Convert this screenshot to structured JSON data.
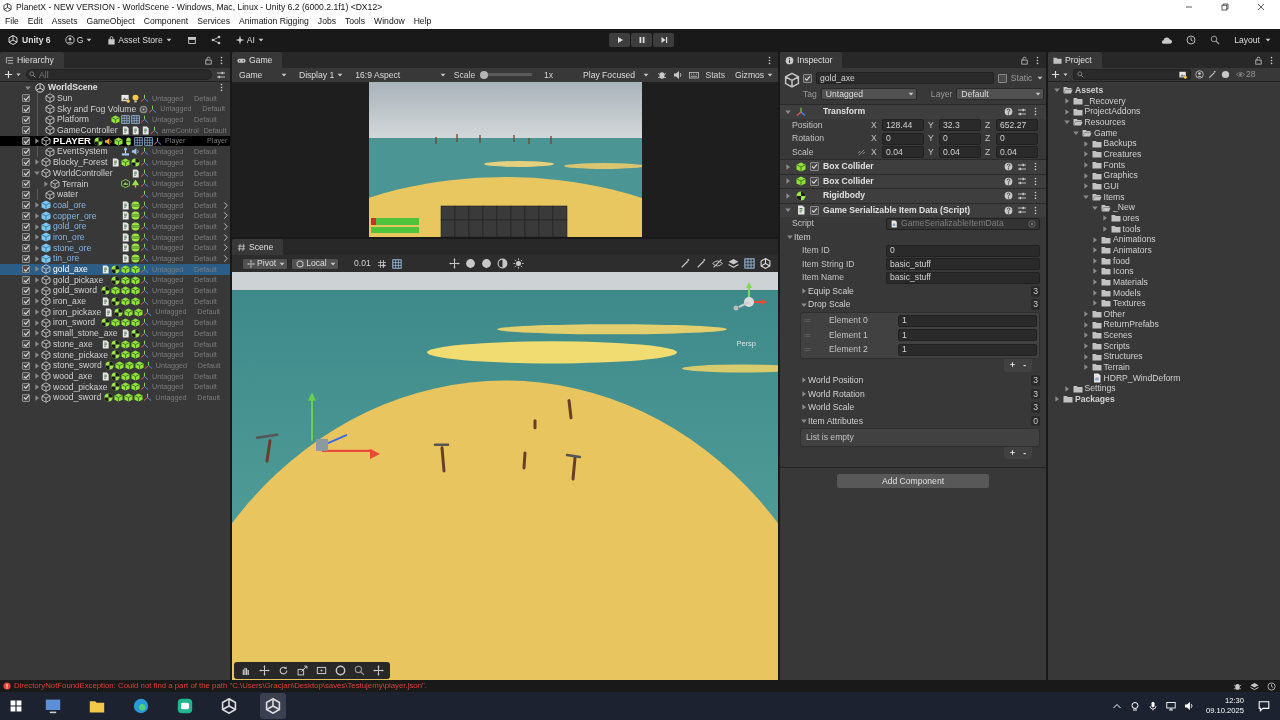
{
  "window": {
    "title": "PlanetX - NEW VERSION - WorldScene - Windows, Mac, Linux - Unity 6.2 (6000.2.1f1) <DX12>"
  },
  "menu": [
    "File",
    "Edit",
    "Assets",
    "GameObject",
    "Component",
    "Services",
    "Animation Rigging",
    "Jobs",
    "Tools",
    "Window",
    "Help"
  ],
  "toolbar": {
    "version": "Unity 6",
    "account": "G",
    "asset_store": "Asset Store",
    "ai": "AI",
    "layout": "Layout"
  },
  "hierarchy": {
    "tab": "Hierarchy",
    "search_placeholder": "All",
    "scene": {
      "name": "WorldScene",
      "expanded": true
    },
    "items": [
      {
        "name": "Sun",
        "kind": "object",
        "checked": true,
        "selected": false,
        "components": [
          {
            "kind": "picture"
          },
          {
            "kind": "light"
          }
        ],
        "tag": "Untagged",
        "layer": "Default"
      },
      {
        "name": "Sky and Fog Volume",
        "kind": "object",
        "checked": true,
        "selected": false,
        "components": [
          {
            "kind": "volume"
          }
        ],
        "tag": "Untagged",
        "layer": "Default"
      },
      {
        "name": "Platform",
        "kind": "object",
        "checked": true,
        "selected": false,
        "components": [
          {
            "kind": "collider"
          },
          {
            "kind": "grid"
          },
          {
            "kind": "grid"
          }
        ],
        "tag": "Untagged",
        "layer": "Default"
      },
      {
        "name": "GameController",
        "kind": "object",
        "checked": true,
        "selected": false,
        "components": [
          {
            "kind": "script"
          },
          {
            "kind": "script"
          },
          {
            "kind": "script"
          }
        ],
        "tag": "ameControl",
        "layer": "Default"
      },
      {
        "name": "PLAYER",
        "kind": "highlighted",
        "checked": true,
        "selected": false,
        "expanded": false,
        "components": [
          {
            "kind": "rigidbody"
          },
          {
            "kind": "audio"
          },
          {
            "kind": "collider"
          },
          {
            "kind": "capsule"
          },
          {
            "kind": "grid"
          },
          {
            "kind": "grid"
          }
        ],
        "tag": "Player",
        "layer": "Player"
      },
      {
        "name": "EventSystem",
        "kind": "object",
        "checked": true,
        "selected": false,
        "components": [
          {
            "kind": "joystick"
          },
          {
            "kind": "speaker"
          }
        ],
        "tag": "Untagged",
        "layer": "Default"
      },
      {
        "name": "Blocky_Forest",
        "kind": "object",
        "checked": true,
        "selected": false,
        "expanded": false,
        "components": [
          {
            "kind": "script"
          },
          {
            "kind": "collider"
          },
          {
            "kind": "rigidbody"
          }
        ],
        "tag": "Untagged",
        "layer": "Default"
      },
      {
        "name": "WorldController",
        "kind": "object",
        "checked": true,
        "selected": false,
        "expanded": true,
        "components": [
          {
            "kind": "script"
          }
        ],
        "tag": "Untagged",
        "layer": "Default",
        "children": [
          {
            "name": "Terrain",
            "kind": "object",
            "checked": true,
            "selected": false,
            "expanded": false,
            "components": [
              {
                "kind": "terrain"
              },
              {
                "kind": "tree"
              }
            ],
            "tag": "Untagged",
            "layer": "Default"
          }
        ]
      },
      {
        "name": "water",
        "kind": "object",
        "checked": true,
        "selected": false,
        "tag": "Untagged",
        "layer": "Default"
      },
      {
        "name": "coal_ore",
        "kind": "prefab",
        "checked": true,
        "selected": false,
        "expanded": false,
        "components": [
          {
            "kind": "script"
          },
          {
            "kind": "sphere"
          }
        ],
        "tag": "Untagged",
        "layer": "Default"
      },
      {
        "name": "copper_ore",
        "kind": "prefab",
        "checked": true,
        "selected": false,
        "expanded": false,
        "components": [
          {
            "kind": "script"
          },
          {
            "kind": "sphere"
          }
        ],
        "tag": "Untagged",
        "layer": "Default"
      },
      {
        "name": "gold_ore",
        "kind": "prefab",
        "checked": true,
        "selected": false,
        "expanded": false,
        "components": [
          {
            "kind": "script"
          },
          {
            "kind": "sphere"
          }
        ],
        "tag": "Untagged",
        "layer": "Default"
      },
      {
        "name": "iron_ore",
        "kind": "prefab",
        "checked": true,
        "selected": false,
        "expanded": false,
        "components": [
          {
            "kind": "script"
          },
          {
            "kind": "sphere"
          }
        ],
        "tag": "Untagged",
        "layer": "Default"
      },
      {
        "name": "stone_ore",
        "kind": "prefab",
        "checked": true,
        "selected": false,
        "expanded": false,
        "components": [
          {
            "kind": "script"
          },
          {
            "kind": "sphere"
          }
        ],
        "tag": "Untagged",
        "layer": "Default"
      },
      {
        "name": "tin_ore",
        "kind": "prefab",
        "checked": true,
        "selected": false,
        "expanded": false,
        "components": [
          {
            "kind": "script"
          },
          {
            "kind": "sphere"
          }
        ],
        "tag": "Untagged",
        "layer": "Default"
      },
      {
        "name": "gold_axe",
        "kind": "object",
        "checked": true,
        "selected": true,
        "expanded": false,
        "components": [
          {
            "kind": "script"
          },
          {
            "kind": "rigidbody"
          },
          {
            "kind": "collider"
          },
          {
            "kind": "collider"
          }
        ],
        "tag": "Untagged",
        "layer": "Default"
      },
      {
        "name": "gold_pickaxe",
        "kind": "object",
        "checked": true,
        "selected": false,
        "expanded": false,
        "components": [
          {
            "kind": "rigidbody"
          },
          {
            "kind": "collider"
          },
          {
            "kind": "collider"
          }
        ],
        "tag": "Untagged",
        "layer": "Default"
      },
      {
        "name": "gold_sword",
        "kind": "object",
        "checked": true,
        "selected": false,
        "expanded": false,
        "components": [
          {
            "kind": "rigidbody"
          },
          {
            "kind": "collider"
          },
          {
            "kind": "collider"
          },
          {
            "kind": "collider"
          }
        ],
        "tag": "Untagged",
        "layer": "Default"
      },
      {
        "name": "iron_axe",
        "kind": "object",
        "checked": true,
        "selected": false,
        "expanded": false,
        "components": [
          {
            "kind": "script"
          },
          {
            "kind": "rigidbody"
          },
          {
            "kind": "collider"
          },
          {
            "kind": "collider"
          }
        ],
        "tag": "Untagged",
        "layer": "Default"
      },
      {
        "name": "iron_pickaxe",
        "kind": "object",
        "checked": true,
        "selected": false,
        "expanded": false,
        "components": [
          {
            "kind": "script"
          },
          {
            "kind": "rigidbody"
          },
          {
            "kind": "collider"
          },
          {
            "kind": "collider"
          }
        ],
        "tag": "Untagged",
        "layer": "Default"
      },
      {
        "name": "iron_sword",
        "kind": "object",
        "checked": true,
        "selected": false,
        "expanded": false,
        "components": [
          {
            "kind": "rigidbody"
          },
          {
            "kind": "collider"
          },
          {
            "kind": "collider"
          },
          {
            "kind": "collider"
          }
        ],
        "tag": "Untagged",
        "layer": "Default"
      },
      {
        "name": "small_stone_axe",
        "kind": "object",
        "checked": true,
        "selected": false,
        "expanded": false,
        "components": [
          {
            "kind": "script"
          },
          {
            "kind": "rigidbody"
          }
        ],
        "tag": "Untagged",
        "layer": "Default"
      },
      {
        "name": "stone_axe",
        "kind": "object",
        "checked": true,
        "selected": false,
        "expanded": false,
        "components": [
          {
            "kind": "script"
          },
          {
            "kind": "rigidbody"
          },
          {
            "kind": "collider"
          },
          {
            "kind": "collider"
          }
        ],
        "tag": "Untagged",
        "layer": "Default"
      },
      {
        "name": "stone_pickaxe",
        "kind": "object",
        "checked": true,
        "selected": false,
        "expanded": false,
        "components": [
          {
            "kind": "rigidbody"
          },
          {
            "kind": "collider"
          },
          {
            "kind": "collider"
          }
        ],
        "tag": "Untagged",
        "layer": "Default"
      },
      {
        "name": "stone_sword",
        "kind": "object",
        "checked": true,
        "selected": false,
        "expanded": false,
        "components": [
          {
            "kind": "rigidbody"
          },
          {
            "kind": "collider"
          },
          {
            "kind": "collider"
          },
          {
            "kind": "collider"
          }
        ],
        "tag": "Untagged",
        "layer": "Default"
      },
      {
        "name": "wood_axe",
        "kind": "object",
        "checked": true,
        "selected": false,
        "expanded": false,
        "components": [
          {
            "kind": "script"
          },
          {
            "kind": "rigidbody"
          },
          {
            "kind": "collider"
          },
          {
            "kind": "collider"
          }
        ],
        "tag": "Untagged",
        "layer": "Default"
      },
      {
        "name": "wood_pickaxe",
        "kind": "object",
        "checked": true,
        "selected": false,
        "expanded": false,
        "components": [
          {
            "kind": "rigidbody"
          },
          {
            "kind": "collider"
          },
          {
            "kind": "collider"
          }
        ],
        "tag": "Untagged",
        "layer": "Default"
      },
      {
        "name": "wood_sword",
        "kind": "object",
        "checked": true,
        "selected": false,
        "expanded": false,
        "components": [
          {
            "kind": "rigidbody"
          },
          {
            "kind": "collider"
          },
          {
            "kind": "collider"
          },
          {
            "kind": "collider"
          }
        ],
        "tag": "Untagged",
        "layer": "Default"
      }
    ]
  },
  "game": {
    "tab": "Game",
    "view": "Game",
    "display": "Display 1",
    "aspect": "16:9 Aspect",
    "scale_label": "Scale",
    "scale_slider": {
      "level": 0.06
    },
    "scale": "1x",
    "play_mode": "Play Focused",
    "stats": "Stats",
    "gizmos": "Gizmos"
  },
  "scene": {
    "tab": "Scene",
    "pivot": "Pivot",
    "space": "Local",
    "snap": "0.01",
    "projection": "Persp"
  },
  "inspector": {
    "tab": "Inspector",
    "object": {
      "name": "gold_axe",
      "active": true,
      "static_label": "Static",
      "static": false,
      "tag_label": "Tag",
      "tag": "Untagged",
      "layer_label": "Layer",
      "layer": "Default"
    },
    "components": [
      {
        "kind": "transform",
        "title": "Transform",
        "expanded": true,
        "rows": [
          {
            "label": "Position",
            "axes": [
              {
                "axis": "X",
                "value": "128.44"
              },
              {
                "axis": "Y",
                "value": "32.3"
              },
              {
                "axis": "Z",
                "value": "652.27"
              }
            ]
          },
          {
            "label": "Rotation",
            "axes": [
              {
                "axis": "X",
                "value": "0"
              },
              {
                "axis": "Y",
                "value": "0"
              },
              {
                "axis": "Z",
                "value": "0"
              }
            ]
          },
          {
            "label": "Scale",
            "scale_link": false,
            "axes": [
              {
                "axis": "X",
                "value": "0.04"
              },
              {
                "axis": "Y",
                "value": "0.04"
              },
              {
                "axis": "Z",
                "value": "0.04"
              }
            ]
          }
        ]
      },
      {
        "kind": "collider",
        "title": "Box Collider",
        "expanded": false,
        "enabled": true
      },
      {
        "kind": "collider",
        "title": "Box Collider",
        "expanded": false,
        "enabled": true
      },
      {
        "kind": "rigidbody",
        "title": "Rigidbody",
        "expanded": false
      },
      {
        "kind": "script",
        "title": "Game Serializable Item Data (Script)",
        "expanded": true,
        "enabled": true,
        "script_label": "Script",
        "script": "GameSerializableItemData",
        "group": {
          "label": "Item",
          "expanded": true,
          "fields": [
            {
              "kind": "field",
              "label": "Item ID",
              "value": "0"
            },
            {
              "kind": "field",
              "label": "Item String ID",
              "value": "basic_stuff"
            },
            {
              "kind": "field",
              "label": "Item Name",
              "value": "basic_stuff"
            },
            {
              "kind": "list",
              "label": "Equip Scale",
              "count": "3",
              "expanded": false
            },
            {
              "kind": "list",
              "label": "Drop Scale",
              "count": "3",
              "expanded": true,
              "elements": [
                {
                  "label": "Element 0",
                  "value": "1"
                },
                {
                  "label": "Element 1",
                  "value": "1"
                },
                {
                  "label": "Element 2",
                  "value": "1"
                }
              ],
              "add": "+",
              "remove": "-"
            },
            {
              "kind": "list",
              "label": "World Position",
              "count": "3",
              "expanded": false
            },
            {
              "kind": "list",
              "label": "World Rotation",
              "count": "3",
              "expanded": false
            },
            {
              "kind": "list",
              "label": "World Scale",
              "count": "3",
              "expanded": false
            },
            {
              "kind": "list",
              "label": "Item Attributes",
              "count": "0",
              "expanded": true,
              "empty_text": "List is empty",
              "add": "+",
              "remove": "-"
            }
          ]
        }
      }
    ],
    "add_component": "Add Component"
  },
  "project": {
    "tab": "Project",
    "hidden_count": "28",
    "tree": [
      {
        "name": "Assets",
        "kind": "folder",
        "expanded": true,
        "children": [
          {
            "name": "_Recovery",
            "kind": "folder",
            "expanded": false
          },
          {
            "name": "ProjectAddons",
            "kind": "folder",
            "expanded": false
          },
          {
            "name": "Resources",
            "kind": "folder",
            "expanded": true,
            "children": [
              {
                "name": "Game",
                "kind": "folder",
                "expanded": true,
                "children": [
                  {
                    "name": "Backups",
                    "kind": "folder",
                    "expanded": false
                  },
                  {
                    "name": "Creatures",
                    "kind": "folder",
                    "expanded": false
                  },
                  {
                    "name": "Fonts",
                    "kind": "folder",
                    "expanded": false
                  },
                  {
                    "name": "Graphics",
                    "kind": "folder",
                    "expanded": false
                  },
                  {
                    "name": "GUI",
                    "kind": "folder",
                    "expanded": false
                  },
                  {
                    "name": "Items",
                    "kind": "folder",
                    "expanded": true,
                    "children": [
                      {
                        "name": "_New",
                        "kind": "folder",
                        "expanded": true,
                        "children": [
                          {
                            "name": "ores",
                            "kind": "folder",
                            "expanded": false
                          },
                          {
                            "name": "tools",
                            "kind": "folder",
                            "expanded": false
                          }
                        ]
                      },
                      {
                        "name": "Animations",
                        "kind": "folder",
                        "expanded": false
                      },
                      {
                        "name": "Animators",
                        "kind": "folder",
                        "expanded": false
                      },
                      {
                        "name": "food",
                        "kind": "folder",
                        "expanded": false
                      },
                      {
                        "name": "Icons",
                        "kind": "folder",
                        "expanded": false
                      },
                      {
                        "name": "Materials",
                        "kind": "folder",
                        "expanded": false
                      },
                      {
                        "name": "Models",
                        "kind": "folder",
                        "expanded": false
                      },
                      {
                        "name": "Textures",
                        "kind": "folder",
                        "expanded": false
                      }
                    ]
                  },
                  {
                    "name": "Other",
                    "kind": "folder",
                    "expanded": false
                  },
                  {
                    "name": "ReturnPrefabs",
                    "kind": "folder",
                    "expanded": false
                  },
                  {
                    "name": "Scenes",
                    "kind": "folder",
                    "expanded": false
                  },
                  {
                    "name": "Scripts",
                    "kind": "folder",
                    "expanded": false
                  },
                  {
                    "name": "Structures",
                    "kind": "folder",
                    "expanded": false
                  },
                  {
                    "name": "Terrain",
                    "kind": "folder",
                    "expanded": false
                  },
                  {
                    "name": "HDRP_WindDeform",
                    "kind": "file"
                  }
                ]
              }
            ]
          },
          {
            "name": "Settings",
            "kind": "folder",
            "expanded": false
          }
        ]
      },
      {
        "name": "Packages",
        "kind": "folder",
        "expanded": false
      }
    ]
  },
  "status_bar": {
    "message": "DirectoryNotFoundException: Could not find a part of the path \"C:\\Users\\Gracjan\\Desktop\\saves\\Testujemy\\player.json\"."
  },
  "taskbar": {
    "time": "12:30",
    "date": "09.10.2025"
  }
}
